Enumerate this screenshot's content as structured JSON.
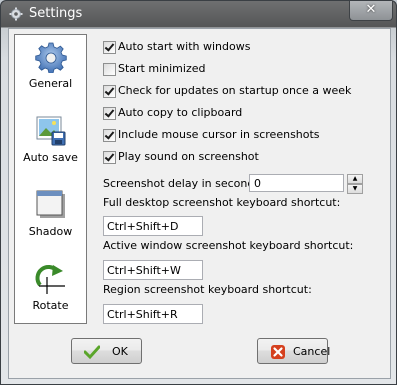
{
  "window": {
    "title": "Settings",
    "close_glyph": "✕"
  },
  "sidebar": {
    "items": [
      {
        "label": "General",
        "icon": "gear-icon"
      },
      {
        "label": "Auto save",
        "icon": "image-save-icon"
      },
      {
        "label": "Shadow",
        "icon": "window-shadow-icon"
      },
      {
        "label": "Rotate",
        "icon": "rotate-icon"
      }
    ]
  },
  "options": [
    {
      "label": "Auto start with windows",
      "checked": true
    },
    {
      "label": "Start minimized",
      "checked": false
    },
    {
      "label": "Check for updates on startup once a week",
      "checked": true
    },
    {
      "label": "Auto copy to clipboard",
      "checked": true
    },
    {
      "label": "Include mouse cursor in screenshots",
      "checked": true
    },
    {
      "label": "Play sound on screenshot",
      "checked": true
    }
  ],
  "delay": {
    "label": "Screenshot delay in seconds:",
    "value": "0"
  },
  "shortcuts": {
    "full": {
      "label": "Full desktop screenshot keyboard shortcut:",
      "value": "Ctrl+Shift+D"
    },
    "active": {
      "label": "Active window screenshot keyboard shortcut:",
      "value": "Ctrl+Shift+W"
    },
    "region": {
      "label": "Region screenshot keyboard shortcut:",
      "value": "Ctrl+Shift+R"
    }
  },
  "buttons": {
    "ok": "OK",
    "cancel": "Cancel"
  },
  "colors": {
    "ok_check": "#5aa52a",
    "cancel_x": "#d5401e",
    "titlebar": "#5e5f60"
  }
}
